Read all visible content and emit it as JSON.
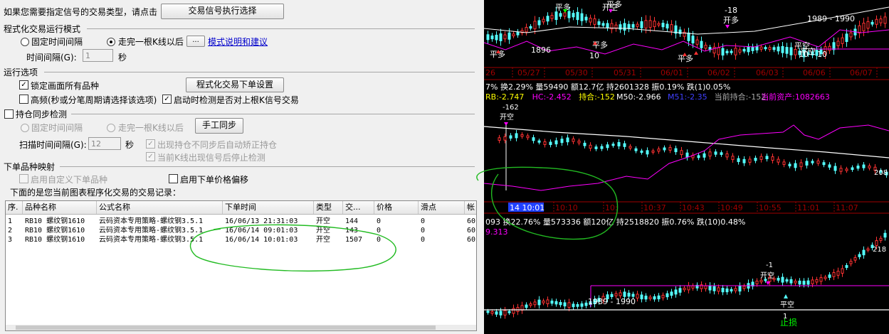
{
  "left": {
    "prompt": "如果您需要指定信号的交易类型，请点击",
    "signal_button": "交易信号执行选择",
    "mode_group": "程式化交易运行模式",
    "fixed_interval": "固定时间间隔",
    "after_bar": "走完一根K线以后",
    "dots_button": "...",
    "mode_link": "模式说明和建议",
    "interval_label": "时间间隔(G):",
    "interval_value": "1",
    "sec_unit": "秒",
    "options_group": "运行选项",
    "lock_all": "锁定画面所有品种",
    "order_settings_button": "程式化交易下单设置",
    "high_freq": "高频(秒或分笔周期请选择该选项)",
    "startup_check": "启动时检测是否对上根K信号交易",
    "pos_sync": "持仓同步检测",
    "pos_fixed": "固定时间间隔",
    "pos_after_bar": "走完一根K线以后",
    "manual_sync": "手工同步",
    "scan_label": "扫描时间间隔(G):",
    "scan_value": "12",
    "scan_unit": "秒",
    "auto_fix": "出现持仓不同步后自动矫正持仓",
    "stop_check": "当前K线出现信号后停止检测",
    "mapping_group": "下单品种映射",
    "custom_symbol": "启用自定义下单品种",
    "price_offset": "启用下单价格偏移",
    "records_label": "下面的是您当前图表程序化交易的交易记录："
  },
  "table": {
    "headers": [
      "序.",
      "品种名称",
      "公式名称",
      "下单时间",
      "类型",
      "交...",
      "价格",
      "滑点",
      "帐"
    ],
    "rows": [
      [
        "1",
        "RB10 螺纹钢1610",
        "云码资本专用策略-螺纹钢3.5.1",
        "16/06/13 21:31:03",
        "开空",
        "144",
        "0",
        "0",
        "60"
      ],
      [
        "2",
        "RB10 螺纹钢1610",
        "云码资本专用策略-螺纹钢3.5.1",
        "16/06/14 09:01:03",
        "开空",
        "143",
        "0",
        "0",
        "60"
      ],
      [
        "3",
        "RB10 螺纹钢1610",
        "云码资本专用策略-螺纹钢3.5.1",
        "16/06/14 10:01:03",
        "开空",
        "1507",
        "0",
        "0",
        "60"
      ]
    ]
  },
  "chart_top": {
    "dates": [
      "26",
      "05/27",
      "05/30",
      "05/31",
      "06/01",
      "06/02",
      "06/03",
      "06/06",
      "06/07"
    ],
    "labels": {
      "pingduo_a": "平多",
      "pingduo_b": "平多",
      "kaikong": "开空",
      "pingduo_c": "平多",
      "n1896": "1896",
      "n10_a": "10",
      "pingduo_d": "平多",
      "pingduo_e": "平多",
      "n10_b": "10",
      "neg18": "-18",
      "kaiduo": "开多",
      "pingkong_a": "平空",
      "range": "1989 - 1990",
      "pingkong_b": "平空",
      "n10_c": "10"
    }
  },
  "chart_mid": {
    "info_line": "7% 换2.29% 量59490 额12.7亿 持2601328 振0.19% 跌(1)0.05%",
    "ind": {
      "rb": "RB:-2.747",
      "hc": "HC:-2.452",
      "chicang": "持合:-152",
      "m50": "M50:-2.966",
      "m51": "M51:-2.35",
      "cur_pos": "当前持合:-152",
      "cur_assets": "当前资产:1082663"
    },
    "marker_val": "-162",
    "marker_label": "开空",
    "right_val": "208",
    "cursor_time": "14 10:01",
    "times": [
      "10:10",
      "10:",
      "10:37",
      "10:43",
      "10:49",
      "10:55",
      "11:01",
      "11:07"
    ]
  },
  "chart_bot": {
    "info_line": "093 换22.76% 量573336 额120亿 持2518820 振0.76% 跌(10)0.48%",
    "left_val": "9.313",
    "right_val": "218",
    "neg1": "-1",
    "kaikong": "开空",
    "pingkong": "平空",
    "one": "1",
    "range": "1989 - 1990",
    "zhisun": "止损"
  },
  "colors": {
    "up": "#ff3232",
    "down": "#54ffff",
    "white": "#ffffff",
    "magenta": "#ff00ff",
    "yellow": "#ffff00",
    "green": "#00ff00",
    "grid_red": "#a00000",
    "annot_green": "#22bb22"
  }
}
